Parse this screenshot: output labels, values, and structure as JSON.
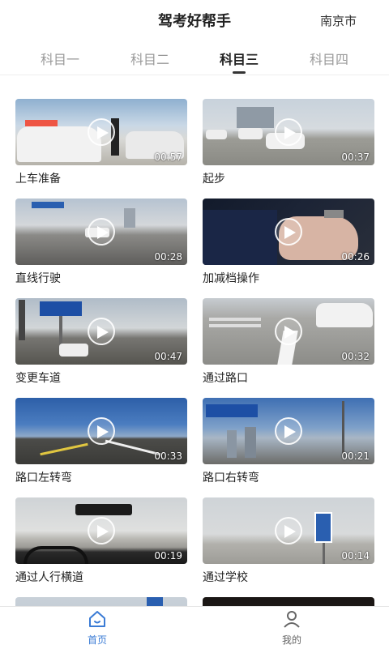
{
  "header": {
    "title": "驾考好帮手",
    "city": "南京市"
  },
  "tabs": [
    {
      "label": "科目一",
      "active": false
    },
    {
      "label": "科目二",
      "active": false
    },
    {
      "label": "科目三",
      "active": true
    },
    {
      "label": "科目四",
      "active": false
    }
  ],
  "videos": [
    {
      "title": "上车准备",
      "duration": "00:57",
      "scene": "sky-car"
    },
    {
      "title": "起步",
      "duration": "00:37",
      "scene": "road-car"
    },
    {
      "title": "直线行驶",
      "duration": "00:28",
      "scene": "highway"
    },
    {
      "title": "加减档操作",
      "duration": "00:26",
      "scene": "dark-hand"
    },
    {
      "title": "变更车道",
      "duration": "00:47",
      "scene": "sign-road"
    },
    {
      "title": "通过路口",
      "duration": "00:32",
      "scene": "crossing"
    },
    {
      "title": "路口左转弯",
      "duration": "00:33",
      "scene": "blue-sky"
    },
    {
      "title": "路口右转弯",
      "duration": "00:21",
      "scene": "sign-blue"
    },
    {
      "title": "通过人行横道",
      "duration": "00:19",
      "scene": "dashboard"
    },
    {
      "title": "通过学校",
      "duration": "00:14",
      "scene": "school"
    }
  ],
  "nav": {
    "home_label": "首页",
    "mine_label": "我的"
  },
  "colors": {
    "accent": "#3a7bd5"
  }
}
